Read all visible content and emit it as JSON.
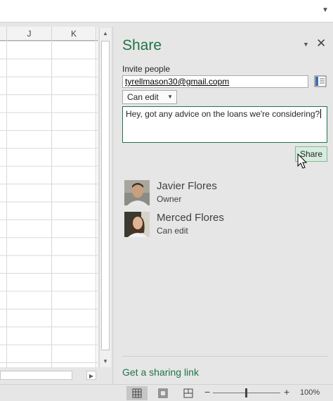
{
  "grid": {
    "columns": [
      "J",
      "K"
    ]
  },
  "share_pane": {
    "title": "Share",
    "invite_label": "Invite people",
    "email_value": "tyrellmason30@gmail.copm",
    "permission_selected": "Can edit",
    "message": "Hey, got any advice on the loans we're considering?",
    "share_button_label": "Share",
    "people": [
      {
        "name": "Javier Flores",
        "role": "Owner"
      },
      {
        "name": "Merced Flores",
        "role": "Can edit"
      }
    ],
    "sharing_link_label": "Get a sharing link"
  },
  "statusbar": {
    "zoom_minus": "−",
    "zoom_plus": "+",
    "zoom_level": "100%"
  },
  "colors": {
    "accent": "#217346",
    "pane_bg": "#e6e6e6"
  }
}
